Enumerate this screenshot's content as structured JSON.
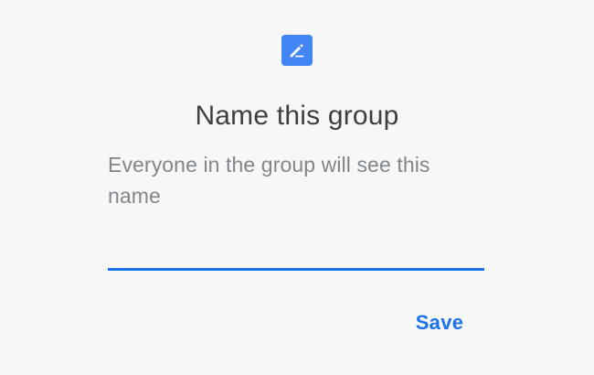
{
  "dialog": {
    "icon_name": "edit-pencil-icon",
    "title": "Name this group",
    "description": "Everyone in the group will see this name",
    "input": {
      "value": "",
      "placeholder": ""
    },
    "save_label": "Save"
  },
  "colors": {
    "background": "#f7f7f7",
    "accent": "#1a73e8",
    "icon_background": "#4285f4",
    "title": "#3c4043",
    "description": "#80868b"
  }
}
